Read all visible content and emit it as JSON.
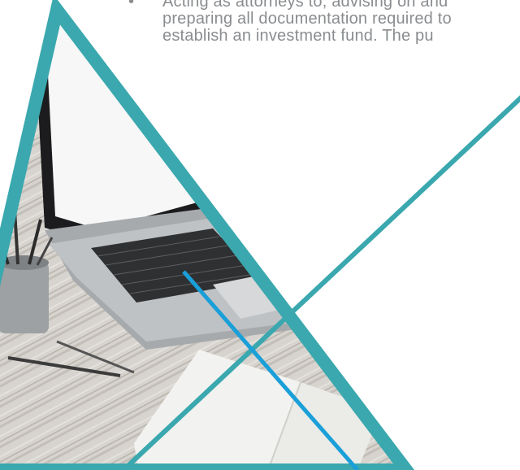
{
  "document": {
    "bullet_symbol": "•",
    "paragraph_lines": [
      "Acting as attorneys to, advising on and",
      "preparing all documentation required to",
      "establish an investment fund. The pu"
    ]
  },
  "colors": {
    "background": "#ffffff",
    "text": "#8a8d90",
    "teal": "#3aa8ae",
    "blue": "#1a9fd8"
  },
  "image": {
    "description_icon": "laptop-desk-photo"
  }
}
